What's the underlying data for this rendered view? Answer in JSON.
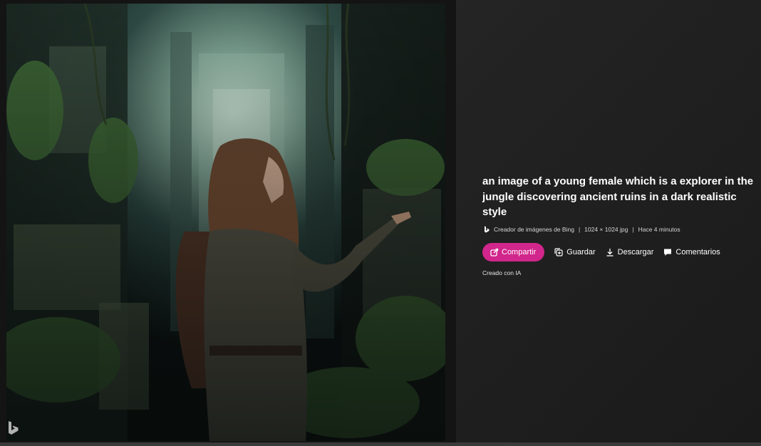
{
  "image": {
    "alt": "an image of a young female which is a explorer in the jungle discovering ancient ruins in a dark realistic style",
    "watermark_icon": "bing-logo-icon"
  },
  "details": {
    "title": "an image of a young female which is a explorer in the jungle discovering ancient ruins in a dark realistic style",
    "meta": {
      "source_icon": "bing-logo-icon",
      "source": "Creador de imágenes de Bing",
      "separator": "|",
      "dimensions": "1024 × 1024 jpg",
      "time": "Hace 4 minutos"
    },
    "actions": {
      "share_label": "Compartir",
      "save_label": "Guardar",
      "download_label": "Descargar",
      "comments_label": "Comentarios"
    },
    "note": "Creado con IA"
  },
  "colors": {
    "accent": "#d1268b",
    "background": "#232323",
    "text": "#ffffff"
  }
}
